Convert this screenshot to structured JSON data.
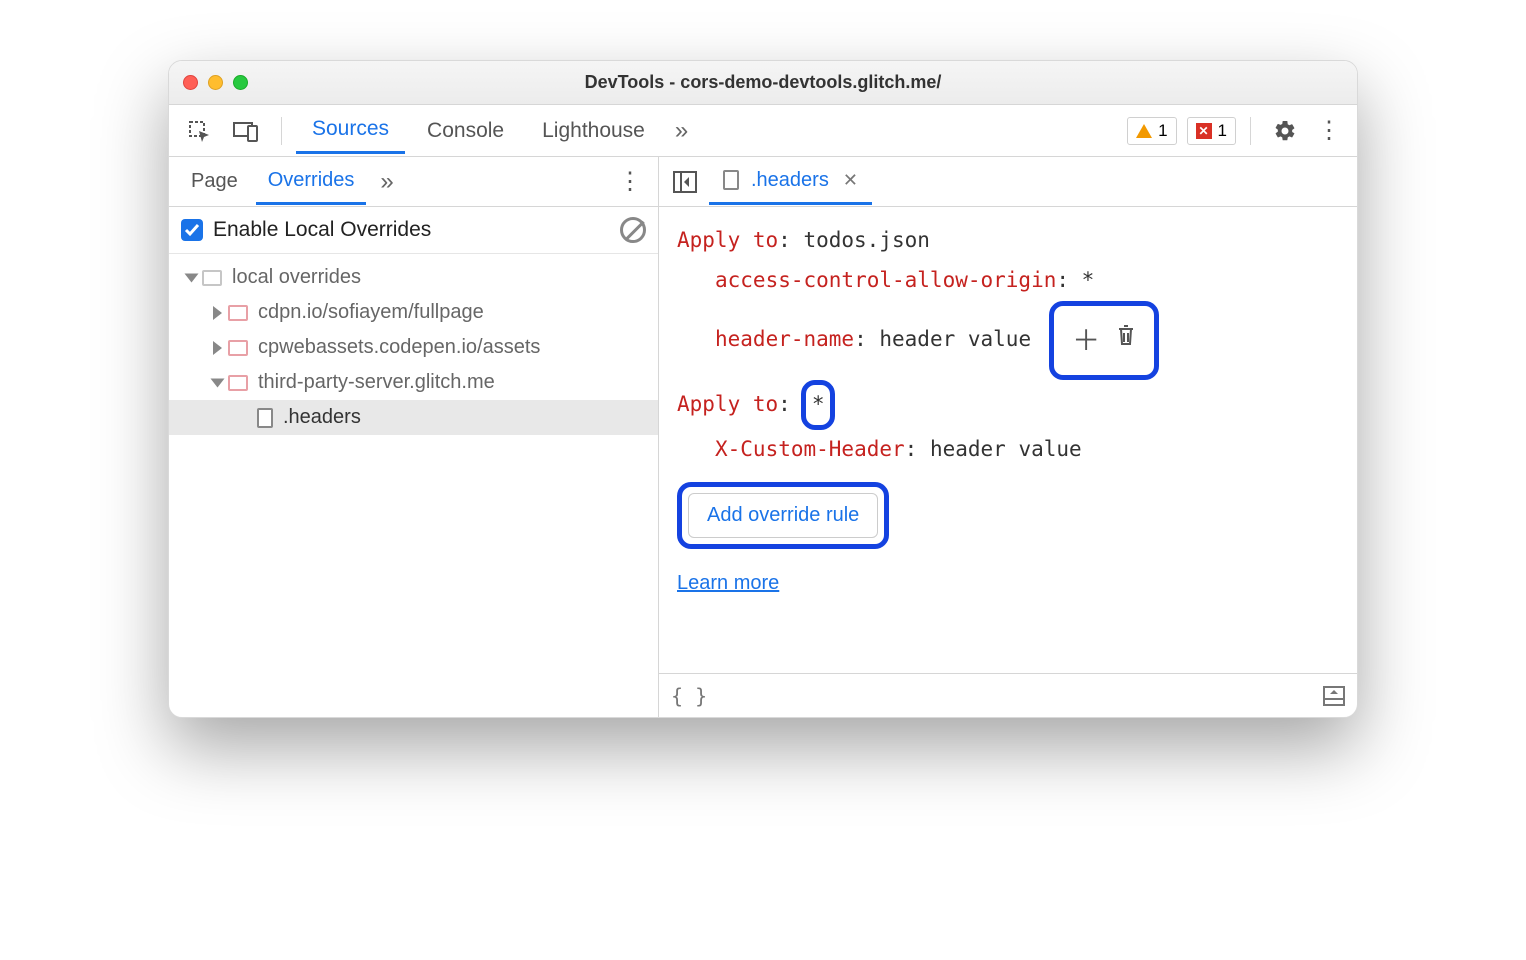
{
  "window": {
    "title": "DevTools - cors-demo-devtools.glitch.me/"
  },
  "toolbar": {
    "tabs": [
      "Sources",
      "Console",
      "Lighthouse"
    ],
    "active_tab": "Sources",
    "warn_count": "1",
    "error_count": "1"
  },
  "left_panel": {
    "tabs": [
      "Page",
      "Overrides"
    ],
    "active_tab": "Overrides",
    "enable_label": "Enable Local Overrides",
    "enabled": true,
    "tree": {
      "root": "local overrides",
      "folders": [
        "cdpn.io/sofiayem/fullpage",
        "cpwebassets.codepen.io/assets",
        "third-party-server.glitch.me"
      ],
      "selected_file": ".headers"
    }
  },
  "editor": {
    "tab_name": ".headers",
    "rules": [
      {
        "apply_label": "Apply to",
        "target": "todos.json",
        "headers": [
          {
            "name": "access-control-allow-origin",
            "value": "*"
          },
          {
            "name": "header-name",
            "value": "header value"
          }
        ]
      },
      {
        "apply_label": "Apply to",
        "target": "*",
        "headers": [
          {
            "name": "X-Custom-Header",
            "value": "header value"
          }
        ]
      }
    ],
    "add_button": "Add override rule",
    "learn_more": "Learn more"
  }
}
